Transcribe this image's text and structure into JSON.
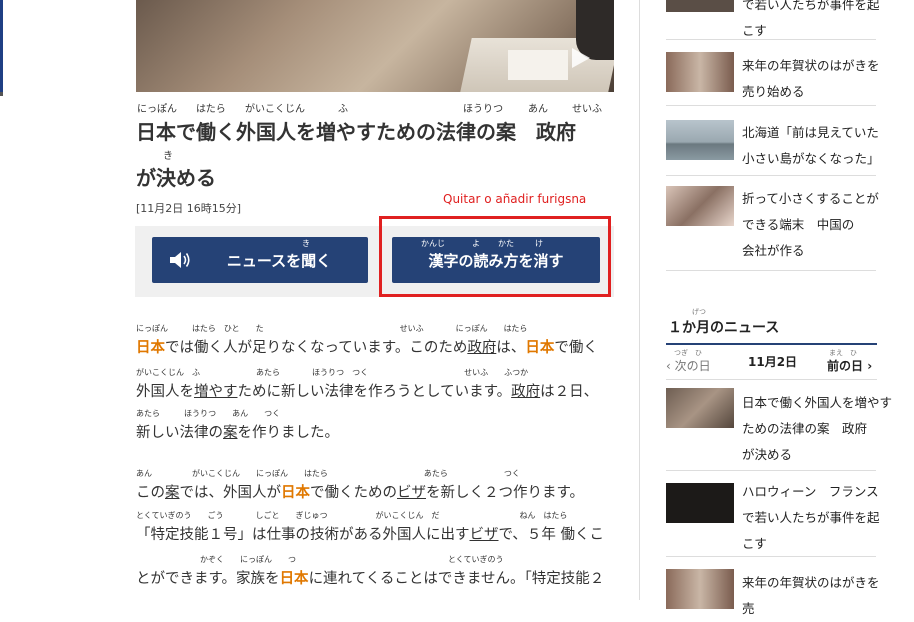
{
  "article": {
    "title_line1": "日本で働く外国人を増やすための法律の案　政府",
    "title_line2": "が決める",
    "title_ruby": [
      {
        "t": "にっぽん"
      },
      {
        "t": "はたら"
      },
      {
        "t": "がいこくじん"
      },
      {
        "t": "ふ"
      },
      {
        "t": "ほうりつ"
      },
      {
        "t": "あん"
      },
      {
        "t": "せいふ"
      },
      {
        "t": "き"
      }
    ],
    "date": "[11月2日 16時15分]",
    "annotation": "Quitar o añadir furigsna",
    "listen_button": "ニュースを聞く",
    "listen_furi": "き",
    "kanji_button": "漢字の読み方を消す",
    "kanji_furi": [
      "かんじ",
      "よ",
      "かた",
      "け"
    ],
    "body": [
      {
        "ruby": "にっぽん　　　はたら　ひと　　た　　　　　　　　　　　　　　　　　せいふ　　　　にっぽん　　はたら",
        "segments": [
          [
            "日本",
            "hl"
          ],
          [
            "では働く人が足りなくなっています。このため",
            ""
          ],
          [
            "政府",
            "ul"
          ],
          [
            "は、",
            ""
          ],
          [
            "日本",
            "hl"
          ],
          [
            "で働く",
            ""
          ]
        ]
      },
      {
        "ruby": "がいこくじん　ふ　　　　　　　あたら　　　　ほうりつ　つく　　　　　　　　　　　　せいふ　　ふつか",
        "segments": [
          [
            "外国人を",
            ""
          ],
          [
            "増やす",
            "ul"
          ],
          [
            "ために新しい法律を作ろうとしています。",
            ""
          ],
          [
            "政府",
            "ul"
          ],
          [
            "は２日、",
            ""
          ]
        ]
      },
      {
        "ruby": "あたら　　　ほうりつ　　あん　　つく",
        "segments": [
          [
            " 新しい法律の",
            ""
          ],
          [
            "案",
            "ul"
          ],
          [
            "を作りました。",
            ""
          ]
        ]
      },
      {
        "ruby": "あん　　　　　がいこくじん　　にっぽん　　はたら　　　　　　　　　　　　あたら　　　　　　　つく",
        "segments": [
          [
            "この",
            ""
          ],
          [
            "案",
            "ul"
          ],
          [
            "では、外国人が",
            ""
          ],
          [
            "日本",
            "hl"
          ],
          [
            "で働くための",
            ""
          ],
          [
            "ビザ",
            "ul"
          ],
          [
            "を新しく２つ作ります。",
            ""
          ]
        ]
      },
      {
        "ruby": "とくていぎのう　　ごう　　　　しごと　　ぎじゅつ　　　　　　がいこくじん　だ　　　　　　　　　　ねん　はたら",
        "segments": [
          [
            "「特定技能１号」は仕事の技術がある外国人に出す",
            ""
          ],
          [
            "ビザ",
            "ul"
          ],
          [
            "で、５年 働くこ",
            ""
          ]
        ]
      },
      {
        "ruby": "　　　　　　　　かぞく　　にっぽん　　つ　　　　　　　　　　　　　　　　　　　とくていぎのう",
        "segments": [
          [
            "とができます。家族を",
            ""
          ],
          [
            "日本",
            "hl"
          ],
          [
            "に連れてくることはできません。「特定技能２",
            ""
          ]
        ]
      }
    ]
  },
  "sidebar": {
    "top_items": [
      {
        "lines": [
          "で若い人たちが事件を起",
          "こす"
        ]
      },
      {
        "lines": [
          "来年の年賀状のはがきを",
          "売り始める"
        ],
        "ruby": "らいねん　ねんがじょう"
      },
      {
        "lines": [
          "北海道「前は見えていた",
          "小さい島がなくなった」"
        ],
        "ruby": "ほっかいどう　まえ　み"
      },
      {
        "lines": [
          "折って小さくすることが",
          "できる端末　中国の",
          "会社が作る"
        ],
        "ruby": "お　　　ちい"
      }
    ],
    "month_title": "１か月のニュース",
    "month_furi": "げつ",
    "prev_label": "次の日",
    "prev_furi": "つぎ　ひ",
    "current_date": "11月2日",
    "next_label": "前の日",
    "next_furi": "まえ　ひ",
    "month_items": [
      {
        "lines": [
          "日本で働く外国人を増やす",
          "ための法律の案　政府",
          "が決める"
        ]
      },
      {
        "lines": [
          "ハロウィーン　フランス",
          "で若い人たちが事件を起",
          "こす"
        ]
      },
      {
        "lines": [
          "来年の年賀状のはがきを",
          "売"
        ]
      }
    ]
  },
  "colors": {
    "accent": "#254276",
    "highlight": "#e07800",
    "annotation": "#e02020"
  }
}
